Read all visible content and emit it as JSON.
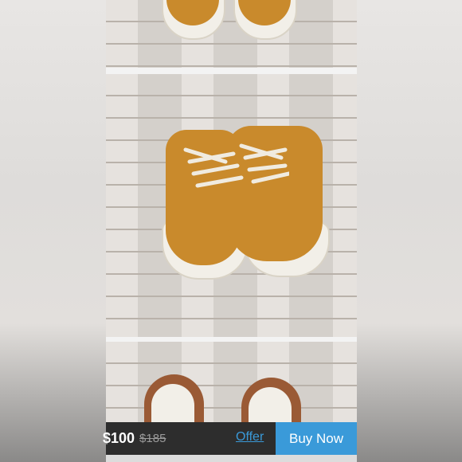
{
  "listing": {
    "price": "$100",
    "original_price": "$185"
  },
  "actions": {
    "offer_label": "Offer",
    "buy_label": "Buy Now"
  },
  "colors": {
    "action_blue": "#3a9ad9",
    "bar_background": "#2d2d2d",
    "suede": "#c98a2c"
  }
}
